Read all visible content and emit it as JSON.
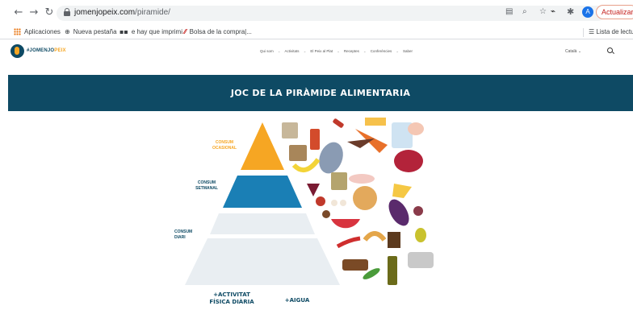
{
  "browser": {
    "url_host": "jomenjopeix.com",
    "url_path": "/piramide/",
    "update_label": "Actualizar",
    "avatar_letter": "A"
  },
  "bookmarks": {
    "apps": "Aplicaciones",
    "new_tab": "Nueva pestaña",
    "printer": "e hay que imprimi",
    "shopping": "Bolsa de la compra|...",
    "reading_list": "Lista de lectu"
  },
  "site": {
    "logo_main": "#JOMENJO",
    "logo_accent": "PEIX",
    "nav": [
      "Qui som",
      "Activitats",
      "El Peix al Plat",
      "Receptes",
      "Conferències",
      "Saber"
    ],
    "lang": "Català"
  },
  "banner": {
    "title": "JOC DE LA PIRÀMIDE ALIMENTARIA"
  },
  "pyramid": {
    "label_top_1": "CONSUM",
    "label_top_2": "OCASIONAL",
    "label_mid_1": "CONSUM",
    "label_mid_2": "SETMANAL",
    "label_low_1": "CONSUM",
    "label_low_2": "DIARI",
    "footer_activity_1": "+ACTIVITAT",
    "footer_activity_2": "FÍSICA DIÀRIA",
    "footer_water": "+AIGUA",
    "colors": {
      "top": "#f6a623",
      "mid": "#1a7fb5",
      "low": "#e9eef2"
    }
  }
}
